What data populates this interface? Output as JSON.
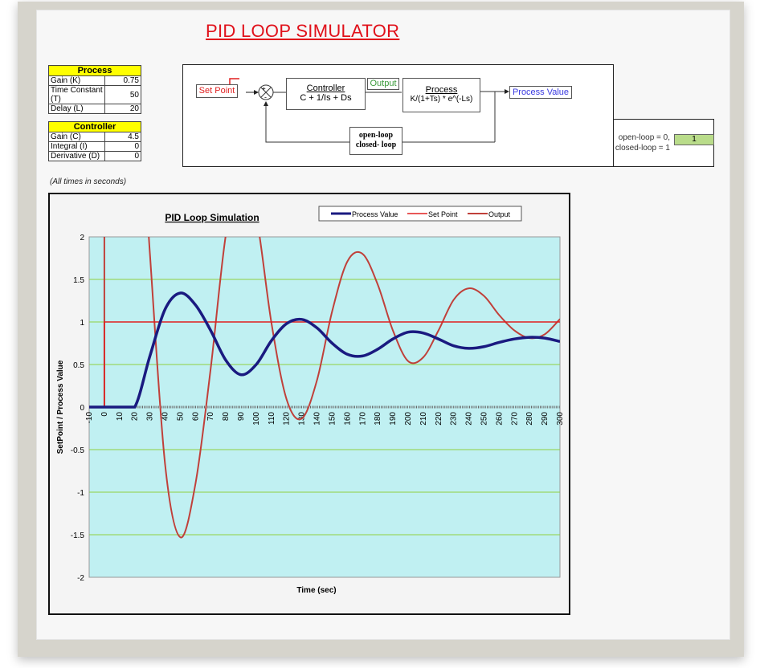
{
  "title": "PID LOOP SIMULATOR",
  "process": {
    "header": "Process",
    "rows": [
      {
        "label": "Gain (K)",
        "value": "0.75"
      },
      {
        "label": "Time Constant (T)",
        "value": "50"
      },
      {
        "label": "Delay (L)",
        "value": "20"
      }
    ]
  },
  "controller": {
    "header": "Controller",
    "rows": [
      {
        "label": "Gain (C)",
        "value": "4.5"
      },
      {
        "label": "Integral (I)",
        "value": "0"
      },
      {
        "label": "Derivative (D)",
        "value": "0"
      }
    ]
  },
  "diagram": {
    "set_point": "Set Point",
    "controller_title": "Controller",
    "controller_formula": "C + 1/Is + Ds",
    "output": "Output",
    "process_title": "Process",
    "process_formula": "K/(1+Ts) * e^(-Ls)",
    "process_value": "Process Value",
    "loop_line1": "open-loop",
    "loop_line2": "closed- loop",
    "plus": "+",
    "minus": "-"
  },
  "loop_mode": {
    "label1": "open-loop = 0,",
    "label2": "closed-loop = 1",
    "value": "1"
  },
  "note": "(All times in seconds)",
  "colors": {
    "pv": "#1a1a80",
    "sp": "#e02020",
    "out": "#c0403a",
    "plot_bg": "#c0f0f2",
    "grid": "#90d040"
  },
  "chart_data": {
    "type": "line",
    "title": "PID Loop Simulation",
    "xlabel": "Time (sec)",
    "ylabel": "SetPoint / Process Value",
    "xlim": [
      -10,
      300
    ],
    "ylim": [
      -2,
      2
    ],
    "xticks": [
      "-10",
      "0",
      "10",
      "20",
      "30",
      "40",
      "50",
      "60",
      "70",
      "80",
      "90",
      "100",
      "110",
      "120",
      "130",
      "140",
      "150",
      "160",
      "170",
      "180",
      "190",
      "200",
      "210",
      "220",
      "230",
      "240",
      "250",
      "260",
      "270",
      "280",
      "290",
      "300"
    ],
    "yticks": [
      "2",
      "1.5",
      "1",
      "0.5",
      "0",
      "-0.5",
      "-1",
      "-1.5",
      "-2"
    ],
    "legend": [
      "Process Value",
      "Set Point",
      "Output"
    ],
    "legend_position": "top-right",
    "x": [
      -10,
      0,
      10,
      20,
      30,
      40,
      50,
      60,
      70,
      80,
      90,
      100,
      110,
      120,
      130,
      140,
      150,
      160,
      170,
      180,
      190,
      200,
      210,
      220,
      230,
      240,
      250,
      260,
      270,
      280,
      290,
      300
    ],
    "series": [
      {
        "name": "Process Value",
        "values": [
          0,
          0,
          0,
          0,
          0.6,
          1.15,
          1.34,
          1.2,
          0.9,
          0.55,
          0.38,
          0.5,
          0.78,
          0.98,
          1.03,
          0.93,
          0.75,
          0.62,
          0.6,
          0.68,
          0.8,
          0.88,
          0.87,
          0.8,
          0.72,
          0.69,
          0.71,
          0.76,
          0.8,
          0.82,
          0.81,
          0.77
        ]
      },
      {
        "name": "Set Point",
        "values": [
          0,
          1,
          1,
          1,
          1,
          1,
          1,
          1,
          1,
          1,
          1,
          1,
          1,
          1,
          1,
          1,
          1,
          1,
          1,
          1,
          1,
          1,
          1,
          1,
          1,
          1,
          1,
          1,
          1,
          1,
          1,
          1
        ]
      },
      {
        "name": "Output",
        "values": [
          0,
          4.5,
          4.5,
          4.5,
          1.8,
          -0.675,
          -1.53,
          -0.9,
          0.45,
          2.025,
          2.79,
          2.25,
          0.99,
          0.09,
          -0.135,
          0.315,
          1.125,
          1.71,
          1.8,
          1.44,
          0.9,
          0.54,
          0.585,
          0.9,
          1.26,
          1.395,
          1.305,
          1.08,
          0.9,
          0.81,
          0.855,
          1.035
        ]
      }
    ]
  }
}
